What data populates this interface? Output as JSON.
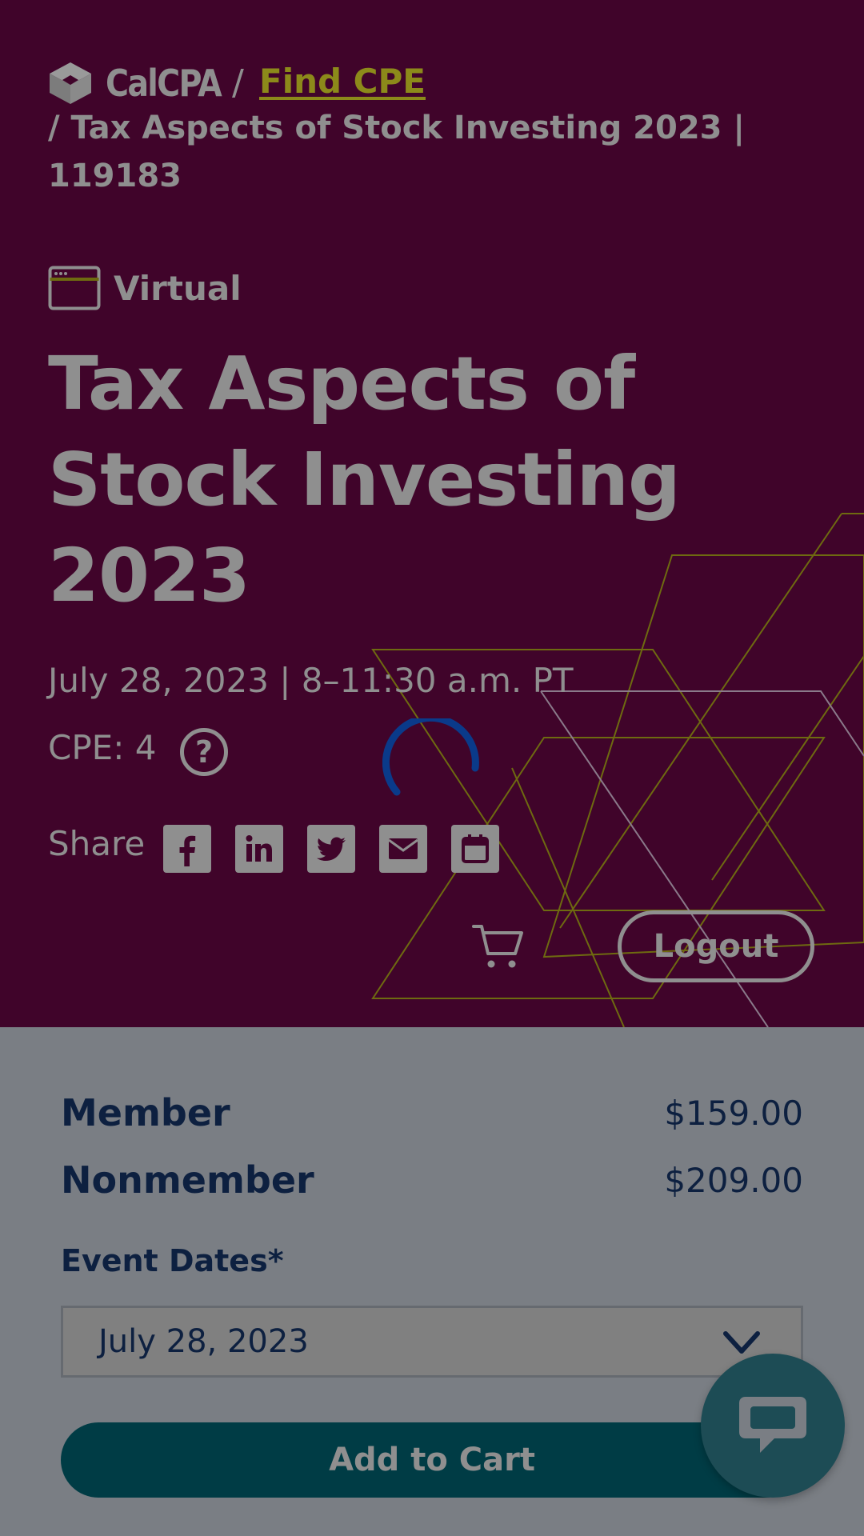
{
  "header": {
    "logo_text": "CalCPA",
    "crumb_separator": "/",
    "crumb_link": "Find CPE",
    "crumb_current": "/ Tax Aspects of Stock Investing 2023 | 119183"
  },
  "event": {
    "format_icon": "browser-window-icon",
    "format_label": "Virtual",
    "title": "Tax Aspects of Stock Investing 2023",
    "datetime": "July 28, 2023 | 8–11:30 a.m. PT",
    "cpe": "CPE: 4",
    "help_symbol": "?"
  },
  "share": {
    "label": "Share",
    "icons": [
      "facebook-icon",
      "linkedin-icon",
      "twitter-icon",
      "email-icon",
      "calendar-icon"
    ]
  },
  "account": {
    "cart_icon": "cart-icon",
    "logout_label": "Logout"
  },
  "pricing": {
    "member_label": "Member",
    "member_price": "$159.00",
    "nonmember_label": "Nonmember",
    "nonmember_price": "$209.00",
    "dates_label": "Event Dates*",
    "selected_date": "July 28, 2023",
    "add_to_cart": "Add to Cart"
  },
  "chat": {
    "icon": "chat-bubble-icon"
  },
  "colors": {
    "hero_bg": "#40042a",
    "link": "#8c8a1a",
    "navy": "#0d2040",
    "button_teal": "#003c45",
    "spinner": "#0a3a8a"
  }
}
